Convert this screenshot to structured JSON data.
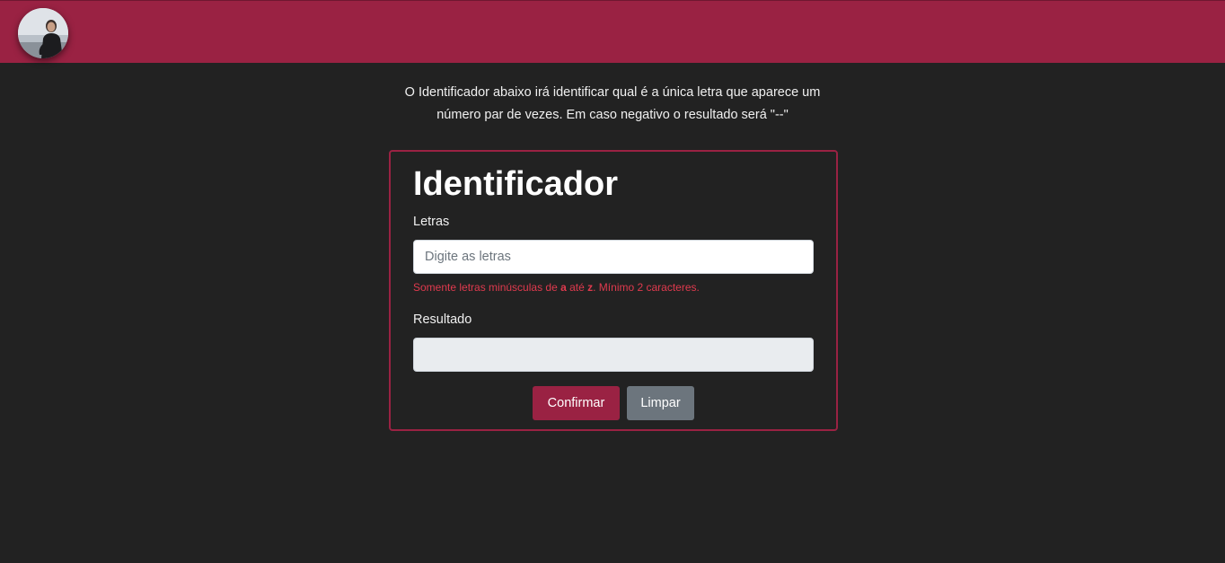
{
  "header": {
    "avatar_alt": "profile photo"
  },
  "intro": {
    "line1": "O Identificador abaixo irá identificar qual é a única letra que aparece um",
    "line2": "número par de vezes. Em caso negativo o resultado será \"--\""
  },
  "form": {
    "title": "Identificador",
    "letters_label": "Letras",
    "letters_placeholder": "Digite as letras",
    "letters_value": "",
    "hint": {
      "part1": "Somente letras minúsculas de ",
      "from": "a",
      "part2": " até ",
      "to": "z",
      "part3": ". Mínimo 2 caracteres."
    },
    "result_label": "Resultado",
    "result_value": "",
    "confirm_label": "Confirmar",
    "clear_label": "Limpar"
  },
  "colors": {
    "accent": "#9a2243",
    "background": "#222222",
    "hint": "#e03a4e",
    "secondary_button": "#6c757d"
  }
}
